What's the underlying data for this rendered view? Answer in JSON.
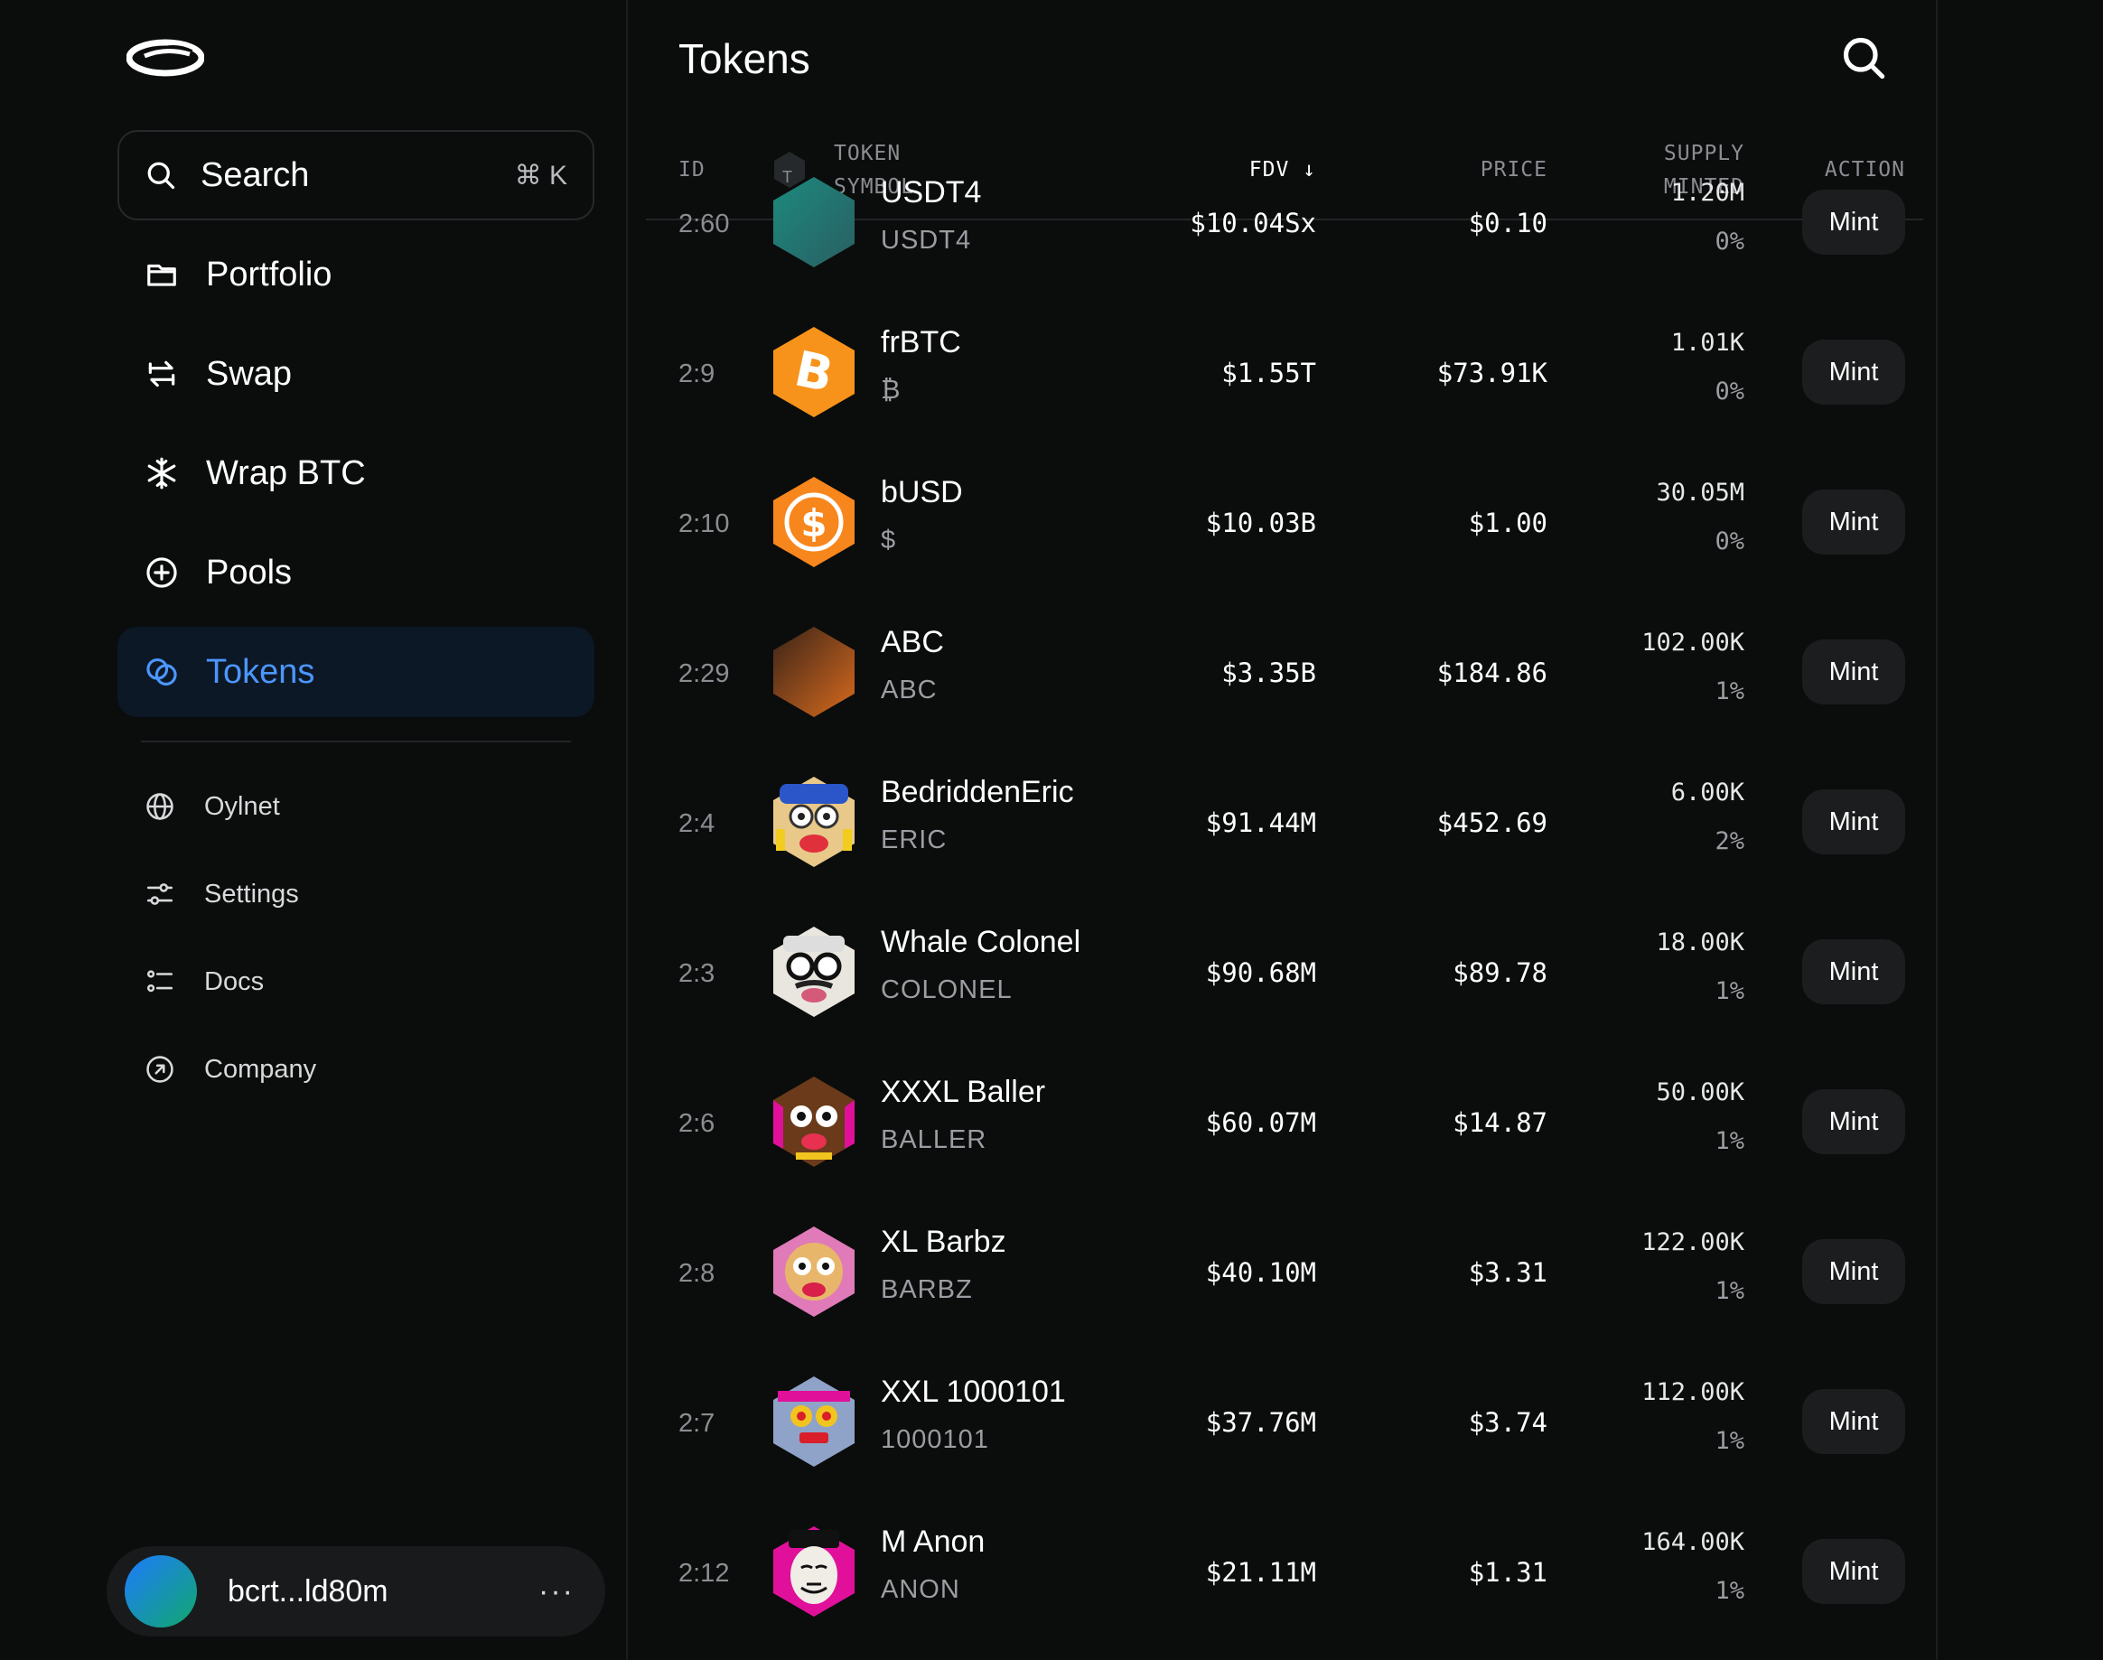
{
  "sidebar": {
    "search": {
      "label": "Search",
      "shortcut": "⌘ K"
    },
    "nav": [
      {
        "label": "Portfolio",
        "icon": "folder-icon"
      },
      {
        "label": "Swap",
        "icon": "swap-icon"
      },
      {
        "label": "Wrap BTC",
        "icon": "snowflake-icon"
      },
      {
        "label": "Pools",
        "icon": "plus-circle-icon"
      },
      {
        "label": "Tokens",
        "icon": "tokens-icon",
        "active": true
      }
    ],
    "secondary": [
      {
        "label": "Oylnet",
        "icon": "globe-icon"
      },
      {
        "label": "Settings",
        "icon": "sliders-icon"
      },
      {
        "label": "Docs",
        "icon": "list-icon"
      },
      {
        "label": "Company",
        "icon": "arrow-up-right-circle-icon"
      }
    ],
    "account": {
      "address": "bcrt...ld80m",
      "more": "···"
    }
  },
  "main": {
    "title": "Tokens",
    "columns": {
      "id": "ID",
      "token_badge": "T",
      "token_line1": "TOKEN",
      "token_line2": "SYMBOL",
      "fdv": "FDV ↓",
      "price": "PRICE",
      "supply_line1": "SUPPLY",
      "supply_line2": "MINTED",
      "action": "ACTION"
    },
    "rows": [
      {
        "id": "2:60",
        "name": "USDT4",
        "symbol": "USDT4",
        "fdv": "$10.04Sx",
        "price": "$0.10",
        "supply": "1.20M",
        "minted": "0%",
        "action": "Mint",
        "icon": "teal-hex-icon"
      },
      {
        "id": "2:9",
        "name": "frBTC",
        "symbol": "₿",
        "fdv": "$1.55T",
        "price": "$73.91K",
        "supply": "1.01K",
        "minted": "0%",
        "action": "Mint",
        "icon": "bitcoin-icon"
      },
      {
        "id": "2:10",
        "name": "bUSD",
        "symbol": "$",
        "fdv": "$10.03B",
        "price": "$1.00",
        "supply": "30.05M",
        "minted": "0%",
        "action": "Mint",
        "icon": "dollar-coin-icon"
      },
      {
        "id": "2:29",
        "name": "ABC",
        "symbol": "ABC",
        "fdv": "$3.35B",
        "price": "$184.86",
        "supply": "102.00K",
        "minted": "1%",
        "action": "Mint",
        "icon": "brown-hex-icon"
      },
      {
        "id": "2:4",
        "name": "BedriddenEric",
        "symbol": "ERIC",
        "fdv": "$91.44M",
        "price": "$452.69",
        "supply": "6.00K",
        "minted": "2%",
        "action": "Mint",
        "icon": "character-eric-icon"
      },
      {
        "id": "2:3",
        "name": "Whale Colonel",
        "symbol": "COLONEL",
        "fdv": "$90.68M",
        "price": "$89.78",
        "supply": "18.00K",
        "minted": "1%",
        "action": "Mint",
        "icon": "character-colonel-icon"
      },
      {
        "id": "2:6",
        "name": "XXXL Baller",
        "symbol": "BALLER",
        "fdv": "$60.07M",
        "price": "$14.87",
        "supply": "50.00K",
        "minted": "1%",
        "action": "Mint",
        "icon": "character-baller-icon"
      },
      {
        "id": "2:8",
        "name": "XL Barbz",
        "symbol": "BARBZ",
        "fdv": "$40.10M",
        "price": "$3.31",
        "supply": "122.00K",
        "minted": "1%",
        "action": "Mint",
        "icon": "character-barbz-icon"
      },
      {
        "id": "2:7",
        "name": "XXL 1000101",
        "symbol": "1000101",
        "fdv": "$37.76M",
        "price": "$3.74",
        "supply": "112.00K",
        "minted": "1%",
        "action": "Mint",
        "icon": "character-1000101-icon"
      },
      {
        "id": "2:12",
        "name": "M Anon",
        "symbol": "ANON",
        "fdv": "$21.11M",
        "price": "$1.31",
        "supply": "164.00K",
        "minted": "1%",
        "action": "Mint",
        "icon": "character-anon-icon"
      }
    ]
  }
}
